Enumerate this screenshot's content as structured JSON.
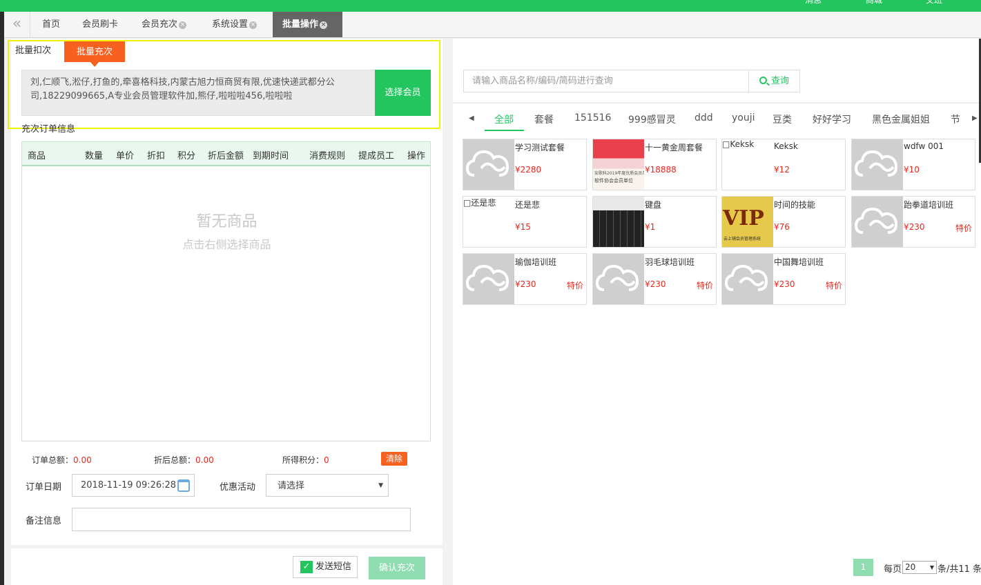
{
  "topbar": {
    "links": [
      "消息",
      "商城",
      "交班"
    ]
  },
  "tabs": [
    {
      "label": "首页",
      "closable": false
    },
    {
      "label": "会员刷卡",
      "closable": false
    },
    {
      "label": "会员充次",
      "closable": true
    },
    {
      "label": "系统设置",
      "closable": true
    },
    {
      "label": "批量操作",
      "closable": true,
      "active": true
    }
  ],
  "subtabs": {
    "deduct": "批量扣次",
    "recharge": "批量充次"
  },
  "members": {
    "text": "刘,仁顺飞,淞仔,打鱼的,牵喜格科技,内蒙古旭力恒商贸有限,优速快递武都分公司,18229099665,A专业会员管理软件加,熊仔,啦啦啦456,啦啦啦",
    "button": "选择会员"
  },
  "order": {
    "title": "充次订单信息",
    "columns": [
      "商品",
      "数量",
      "单价",
      "折扣",
      "积分",
      "折后金额",
      "到期时间",
      "消费规则",
      "提成员工",
      "操作"
    ],
    "empty_title": "暂无商品",
    "empty_sub": "点击右侧选择商品"
  },
  "summary": {
    "total_label": "订单总额：",
    "total_value": "0.00",
    "discount_label": "折后总额：",
    "discount_value": "0.00",
    "points_label": "所得积分：",
    "points_value": "0",
    "clear": "清除"
  },
  "form": {
    "date_label": "订单日期",
    "date_value": "2018-11-19 09:26:28",
    "promo_label": "优惠活动",
    "promo_value": "请选择",
    "note_label": "备注信息"
  },
  "actions": {
    "sms": "发送短信",
    "confirm": "确认充次"
  },
  "search": {
    "placeholder": "请输入商品名称/编码/简码进行查询",
    "button": "查询"
  },
  "categories": [
    "全部",
    "套餐",
    "151516",
    "999感冒灵",
    "ddd",
    "youji",
    "豆类",
    "好好学习",
    "黑色金属姐姐",
    "节"
  ],
  "products": [
    {
      "name": "学习测试套餐",
      "price": "¥2280",
      "special": "",
      "img": "cloud"
    },
    {
      "name": "十一黄金周套餐",
      "price": "¥18888",
      "special": "",
      "img": "red"
    },
    {
      "name": "Keksk",
      "price": "¥12",
      "special": "",
      "img": "broken",
      "alt": "Keksk"
    },
    {
      "name": "wdfw 001",
      "price": "¥10",
      "special": "",
      "img": "cloud"
    },
    {
      "name": "还是悲",
      "price": "¥15",
      "special": "",
      "img": "broken",
      "alt": "还是悲"
    },
    {
      "name": "键盘",
      "price": "¥1",
      "special": "",
      "img": "keyboard"
    },
    {
      "name": "时间的技能",
      "price": "¥76",
      "special": "",
      "img": "vip"
    },
    {
      "name": "跆拳道培训班",
      "price": "¥230",
      "special": "特价",
      "img": "cloud"
    },
    {
      "name": "瑜伽培训班",
      "price": "¥230",
      "special": "特价",
      "img": "cloud"
    },
    {
      "name": "羽毛球培训班",
      "price": "¥230",
      "special": "特价",
      "img": "cloud"
    },
    {
      "name": "中国舞培训班",
      "price": "¥230",
      "special": "特价",
      "img": "cloud"
    }
  ],
  "red_img_text": {
    "line1": "安歌科2019年度优质会员单位",
    "line2": "软件协会会员单位"
  },
  "vip_img_text": {
    "big": "VIP",
    "sub": "云上铺会员管理系统"
  },
  "pager": {
    "current": "1",
    "per_page_label": "每页",
    "per_page": "20",
    "total": "条/共11 条"
  },
  "icons": {
    "calendar": "calendar-icon",
    "search": "search-icon",
    "collapse": "double-chevron-left-icon",
    "close": "close-icon"
  },
  "colors": {
    "accent": "#22c55e",
    "orange": "#f76120",
    "price": "#e8271c"
  }
}
